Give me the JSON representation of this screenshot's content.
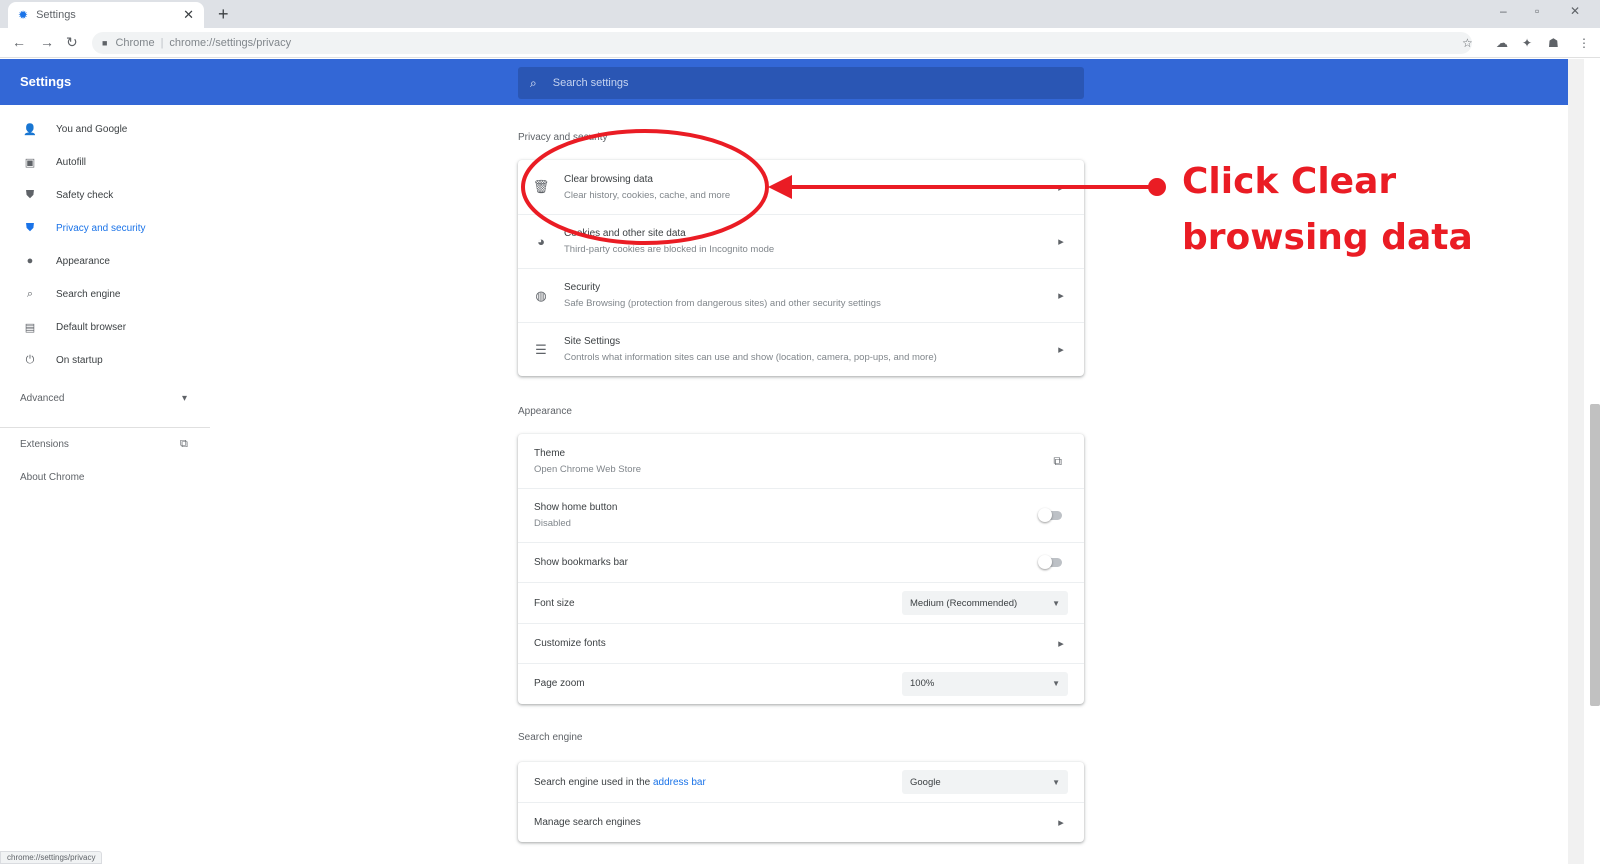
{
  "browser": {
    "tab_title": "Settings",
    "tab_icon": "gear-icon",
    "new_tab": "+",
    "omnibox_site": "Chrome",
    "omnibox_url": "chrome://settings/privacy",
    "status_url": "chrome://settings/privacy"
  },
  "header": {
    "title": "Settings",
    "search_placeholder": "Search settings"
  },
  "sidebar": {
    "items": [
      {
        "label": "You and Google",
        "icon": "person-icon",
        "glyph": "👤"
      },
      {
        "label": "Autofill",
        "icon": "autofill-icon",
        "glyph": "▣"
      },
      {
        "label": "Safety check",
        "icon": "shield-check-icon",
        "glyph": "⛊"
      },
      {
        "label": "Privacy and security",
        "icon": "shield-icon",
        "glyph": "⛊"
      },
      {
        "label": "Appearance",
        "icon": "palette-icon",
        "glyph": "●"
      },
      {
        "label": "Search engine",
        "icon": "search-icon",
        "glyph": "⌕"
      },
      {
        "label": "Default browser",
        "icon": "browser-icon",
        "glyph": "▤"
      },
      {
        "label": "On startup",
        "icon": "power-icon",
        "glyph": "⏻"
      }
    ],
    "advanced": "Advanced",
    "extensions": "Extensions",
    "about": "About Chrome"
  },
  "privacy": {
    "section_title": "Privacy and security",
    "rows": [
      {
        "title": "Clear browsing data",
        "sub": "Clear history, cookies, cache, and more",
        "icon": "trash-icon",
        "glyph": "🗑"
      },
      {
        "title": "Cookies and other site data",
        "sub": "Third-party cookies are blocked in Incognito mode",
        "icon": "cookie-icon",
        "glyph": "◕"
      },
      {
        "title": "Security",
        "sub": "Safe Browsing (protection from dangerous sites) and other security settings",
        "icon": "security-icon",
        "glyph": "◍"
      },
      {
        "title": "Site Settings",
        "sub": "Controls what information sites can use and show (location, camera, pop-ups, and more)",
        "icon": "sliders-icon",
        "glyph": "☰"
      }
    ]
  },
  "appearance": {
    "section_title": "Appearance",
    "theme_title": "Theme",
    "theme_sub": "Open Chrome Web Store",
    "home_title": "Show home button",
    "home_sub": "Disabled",
    "bookmarks_title": "Show bookmarks bar",
    "font_size_label": "Font size",
    "font_size_value": "Medium (Recommended)",
    "customize_fonts": "Customize fonts",
    "page_zoom_label": "Page zoom",
    "page_zoom_value": "100%"
  },
  "search_engine": {
    "section_title": "Search engine",
    "used_prefix": "Search engine used in the",
    "used_link": "address bar",
    "engine_value": "Google",
    "manage": "Manage search engines"
  },
  "annotation": {
    "line1": "Click Clear",
    "line2": "browsing data",
    "color": "#ea1c24"
  }
}
